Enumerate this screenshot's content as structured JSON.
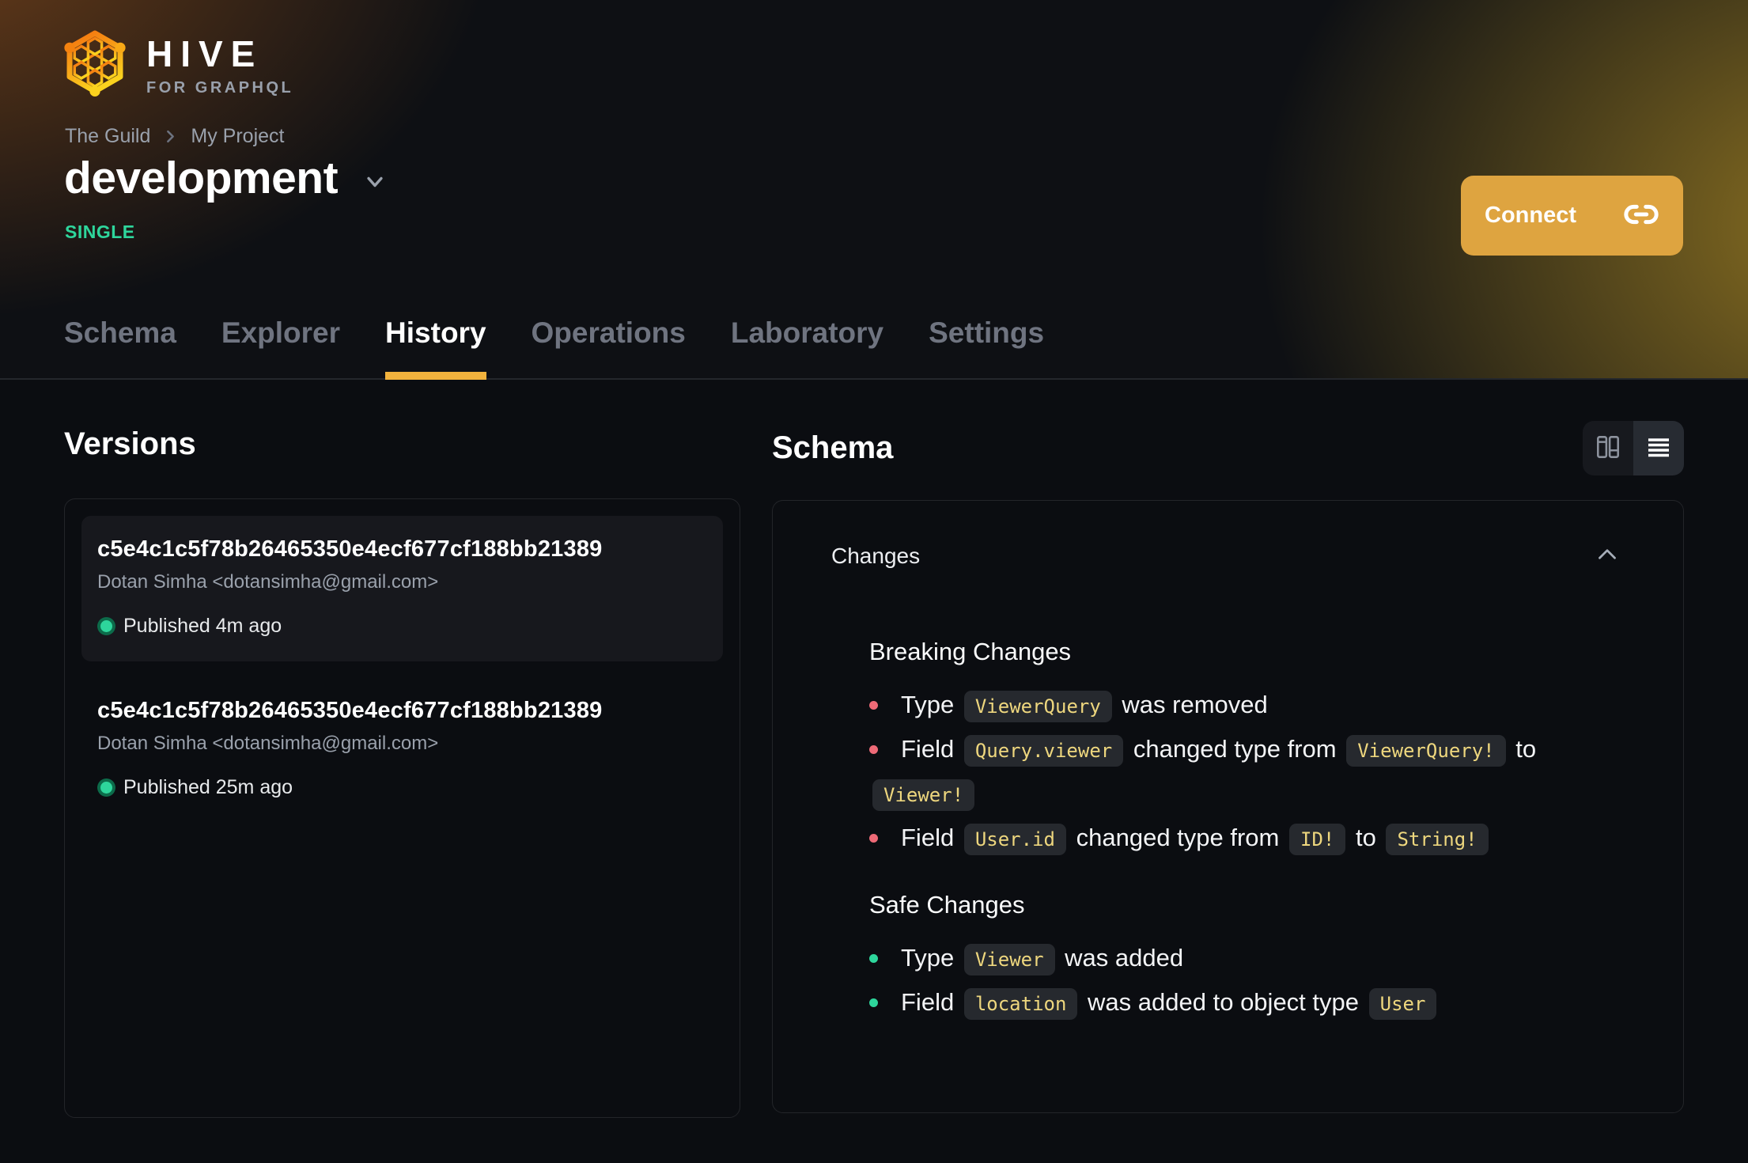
{
  "brand": {
    "name": "HIVE",
    "tagline": "FOR GRAPHQL"
  },
  "breadcrumb": {
    "org": "The Guild",
    "project": "My Project"
  },
  "target": {
    "name": "development",
    "badge": "SINGLE"
  },
  "header": {
    "connect_label": "Connect"
  },
  "tabs": [
    {
      "label": "Schema",
      "active": false
    },
    {
      "label": "Explorer",
      "active": false
    },
    {
      "label": "History",
      "active": true
    },
    {
      "label": "Operations",
      "active": false
    },
    {
      "label": "Laboratory",
      "active": false
    },
    {
      "label": "Settings",
      "active": false
    }
  ],
  "versions": {
    "title": "Versions",
    "items": [
      {
        "hash": "c5e4c1c5f78b26465350e4ecf677cf188bb21389",
        "author": "Dotan Simha <dotansimha@gmail.com>",
        "status": "Published 4m ago"
      },
      {
        "hash": "c5e4c1c5f78b26465350e4ecf677cf188bb21389",
        "author": "Dotan Simha <dotansimha@gmail.com>",
        "status": "Published 25m ago"
      }
    ]
  },
  "schema_panel": {
    "title": "Schema",
    "changes_label": "Changes",
    "breaking": {
      "title": "Breaking Changes",
      "items": [
        {
          "s0": "Type",
          "c0": "ViewerQuery",
          "s1": "was removed"
        },
        {
          "s0": "Field",
          "c0": "Query.viewer",
          "s1": "changed type from",
          "c1": "ViewerQuery!",
          "s2": "to",
          "c2": "Viewer!"
        },
        {
          "s0": "Field",
          "c0": "User.id",
          "s1": "changed type from",
          "c1": "ID!",
          "s2": "to",
          "c2": "String!"
        }
      ]
    },
    "safe": {
      "title": "Safe Changes",
      "items": [
        {
          "s0": "Type",
          "c0": "Viewer",
          "s1": "was added"
        },
        {
          "s0": "Field",
          "c0": "location",
          "s1": "was added to object type",
          "c1": "User"
        }
      ]
    }
  },
  "icons": {
    "connect": "link-icon",
    "view_modes": [
      "columns-view-icon",
      "list-view-icon"
    ],
    "collapse": "chevron-up-icon"
  },
  "colors": {
    "accent_amber": "#f2b33d",
    "connect_button": "#dea440",
    "badge_green": "#2ed69c",
    "safe_green": "#2ed69c",
    "breaking_red": "#ee6a77",
    "code_text": "#eed77e",
    "code_bg": "#26292e",
    "page_bg": "#0b0d11"
  }
}
